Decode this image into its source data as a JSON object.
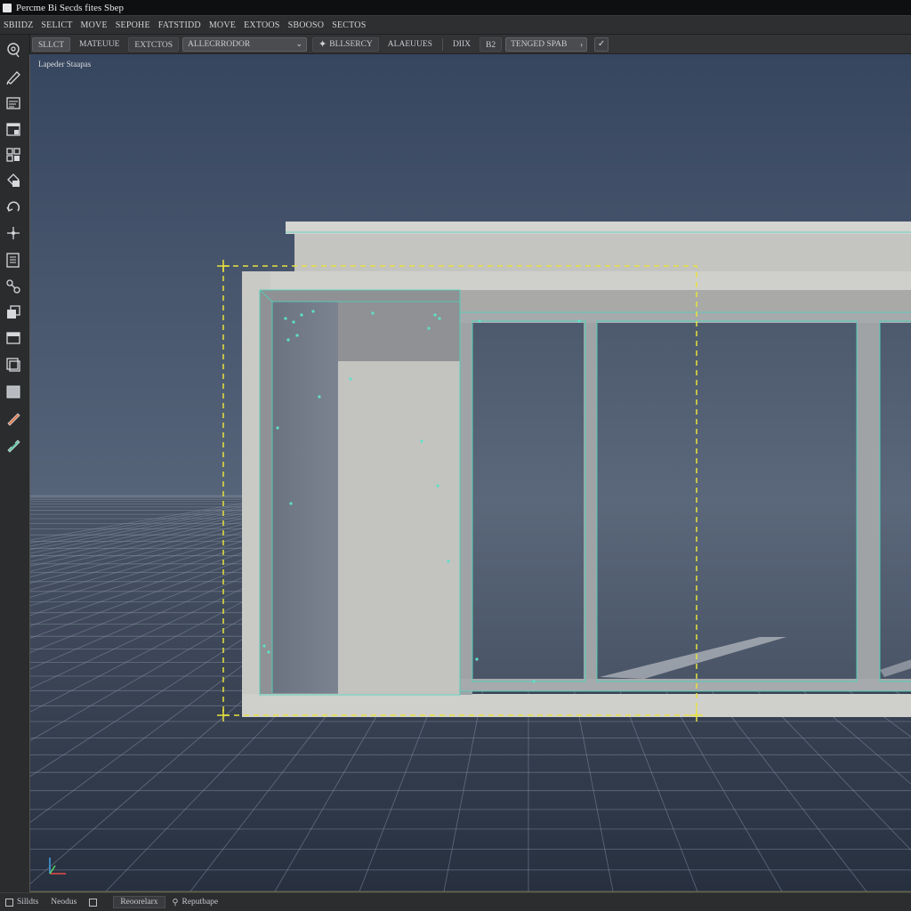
{
  "title": "Percme Bi Secds fites Sbep",
  "menu": [
    "SBIIDZ",
    "SELICT",
    "MOVE",
    "SEPOHE",
    "FATSTIDD",
    "MOVE",
    "EXTOOS",
    "SBOOSO",
    "SECTOS"
  ],
  "toolbar": {
    "select_label": "SLLCT",
    "mateuue_label": "MATEUUE",
    "extctos_label": "EXTCTOS",
    "dropdown_value": "ALLECRRODOR",
    "bllsercy_label": "BLLSERCY",
    "alaeuues_label": "ALAEUUES",
    "dix_label": "DIIX",
    "b2_label": "B2",
    "tengedsp_label": "TENGED SPAB"
  },
  "viewport": {
    "label": "Lapeder Staapas"
  },
  "status": {
    "item1": "Silldts",
    "item2": "Neodus",
    "item3": "Reoorelarx",
    "item4": "Reputbape"
  },
  "colors": {
    "sky_top": "#3a4a64",
    "sky_horizon": "#56647a",
    "ground": "#2c3748",
    "grid_line": "#8a96a8",
    "selection_dashed": "#e8e23c",
    "mesh_outline": "#4fd1b8",
    "concrete": "#c9c9c6"
  },
  "icons": [
    "lasso-icon",
    "pencil-icon",
    "panel-icon",
    "window-icon",
    "grid-icon",
    "paint-bucket-icon",
    "rotate-icon",
    "move-axis-icon",
    "list-icon",
    "node-link-icon",
    "duplicate-icon",
    "browser-icon",
    "layers-icon",
    "shaded-box-icon",
    "knife-icon",
    "bandage-icon"
  ]
}
